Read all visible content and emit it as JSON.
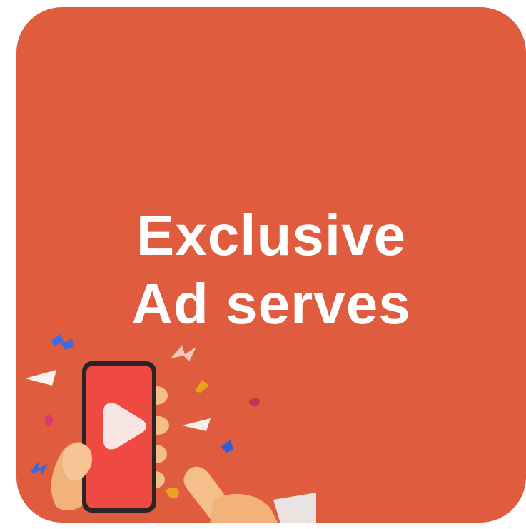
{
  "colors": {
    "card_background": "#E05C3E",
    "text": "#FFFFFF",
    "phone_screen": "#EE4A42",
    "phone_frame": "#2B2325",
    "hand": "#F2B27A"
  },
  "headline": {
    "line1": "Exclusive",
    "line2": "Ad serves"
  },
  "icons": [
    "play-icon",
    "confetti",
    "hand-holding-phone"
  ]
}
